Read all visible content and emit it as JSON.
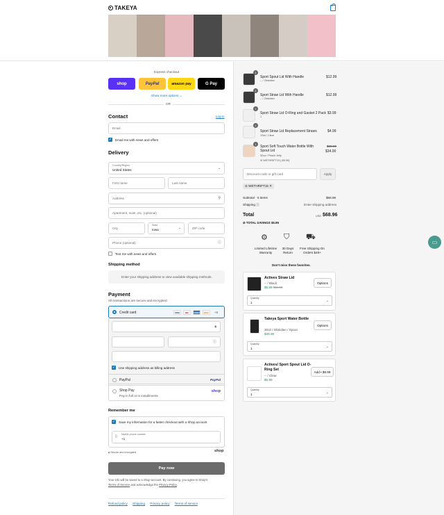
{
  "header": {
    "brand": "TAKEYA"
  },
  "banner_colors": [
    "#d8d0c4",
    "#b9a79a",
    "#e6b9be",
    "#4a4a4a",
    "#c9c2bb",
    "#8f857d",
    "#d6ccc6",
    "#f1c0c8"
  ],
  "express": {
    "title": "Express checkout",
    "shop": "shop",
    "paypal": "PayPal",
    "amazon": "amazon pay",
    "gpay": "G Pay",
    "more": "Show more options",
    "or": "OR"
  },
  "contact": {
    "title": "Contact",
    "login": "Log in",
    "email_placeholder": "Email",
    "news": "Email me with news and offers"
  },
  "delivery": {
    "title": "Delivery",
    "country_label": "Country/Region",
    "country": "United States",
    "first": "First name",
    "last": "Last name",
    "address": "Address",
    "apt": "Apartment, suite, etc. (optional)",
    "city": "City",
    "state_label": "State",
    "state": "Iowa",
    "zip": "ZIP code",
    "phone": "Phone (optional)",
    "text": "Text me with news and offers"
  },
  "shipping": {
    "title": "Shipping method",
    "msg": "Enter your shipping address to view available shipping methods."
  },
  "payment": {
    "title": "Payment",
    "sub": "All transactions are secure and encrypted.",
    "credit": "Credit card",
    "cards": [
      "VISA",
      "MC",
      "AMEX",
      "DISC",
      "+5"
    ],
    "billing": "Use shipping address as billing address",
    "paypal": "PayPal",
    "paypal_logo": "PayPal",
    "shoppay": "Shop Pay",
    "shoppay_sub": "Pay in full or in installments",
    "shop_logo": "shop"
  },
  "remember": {
    "title": "Remember me",
    "save": "Save my information for a faster checkout with a Shop account",
    "mobile_label": "Mobile phone number",
    "mobile": "+1",
    "secure": "Secure and encrypted",
    "shop": "shop"
  },
  "pay": {
    "button": "Pay now",
    "terms1": "Your info will be saved to a Shop account. By continuing, you agree to Shop's",
    "terms2a": "Terms of Service",
    "terms2b": " and acknowledge the ",
    "terms2c": "Privacy Policy",
    "terms2d": "."
  },
  "footer": [
    "Refund policy",
    "Shipping",
    "Privacy policy",
    "Terms of service"
  ],
  "summary": {
    "items": [
      {
        "qty": "1",
        "name": "Sport Spout Lid With Handle",
        "variant": "-- / Obsidian",
        "price": "$12.99",
        "extra": ""
      },
      {
        "qty": "1",
        "name": "Sport Straw Lid With Handle",
        "variant": "-- / Obsidian",
        "price": "$12.99",
        "extra": ""
      },
      {
        "qty": "1",
        "name": "Sport Straw Lid O-Ring and Gasket 2 Pack",
        "variant": "1",
        "price": "$3.99",
        "extra": ""
      },
      {
        "qty": "1",
        "name": "Sport Straw Lid Replacement Straws",
        "variant": "1Set / Clear",
        "price": "$4.99",
        "extra": ""
      },
      {
        "qty": "1",
        "name": "Sport Soft Touch Water Bottle With Spout Lid",
        "variant": "32oz / Peach Jelly",
        "price": "$34.00",
        "old": "$39.99",
        "extra": "WETHRIFT15 (-$5.99)"
      }
    ],
    "discount_placeholder": "Discount code or gift card",
    "apply": "Apply",
    "code": "WETHRIFT15",
    "subtotal_label": "Subtotal · 5 items",
    "subtotal": "$68.96",
    "shipping_label": "Shipping",
    "shipping": "Enter shipping address",
    "total_label": "Total",
    "currency": "USD",
    "total": "$68.96",
    "savings_label": "TOTAL SAVINGS",
    "savings": "$5.99"
  },
  "badges": [
    {
      "label": "Limited Lifetime Warranty"
    },
    {
      "label": "30 Days Return"
    },
    {
      "label": "Free Shipping On Orders $49+"
    }
  ],
  "upsell": {
    "title": "Don't miss these favorites.",
    "items": [
      {
        "name": "Actives Straw Lid",
        "variant": "-- / Black",
        "price": "$5.99",
        "old": "$11.99",
        "action": "Options",
        "qty_label": "Quantity",
        "qty": "1"
      },
      {
        "name": "Takeya Sport Water Bottle",
        "variant": "30oz / Obsidian / Spout",
        "price": "$39.99",
        "old": "",
        "action": "Options",
        "qty_label": "Quantity",
        "qty": "1"
      },
      {
        "name": "Actives/ Sport Spout Lid O-Ring Set",
        "variant": "-- / Clear",
        "price": "$5.99",
        "old": "",
        "action": "Add • $5.99",
        "qty_label": "Quantity",
        "qty": "1"
      }
    ]
  }
}
